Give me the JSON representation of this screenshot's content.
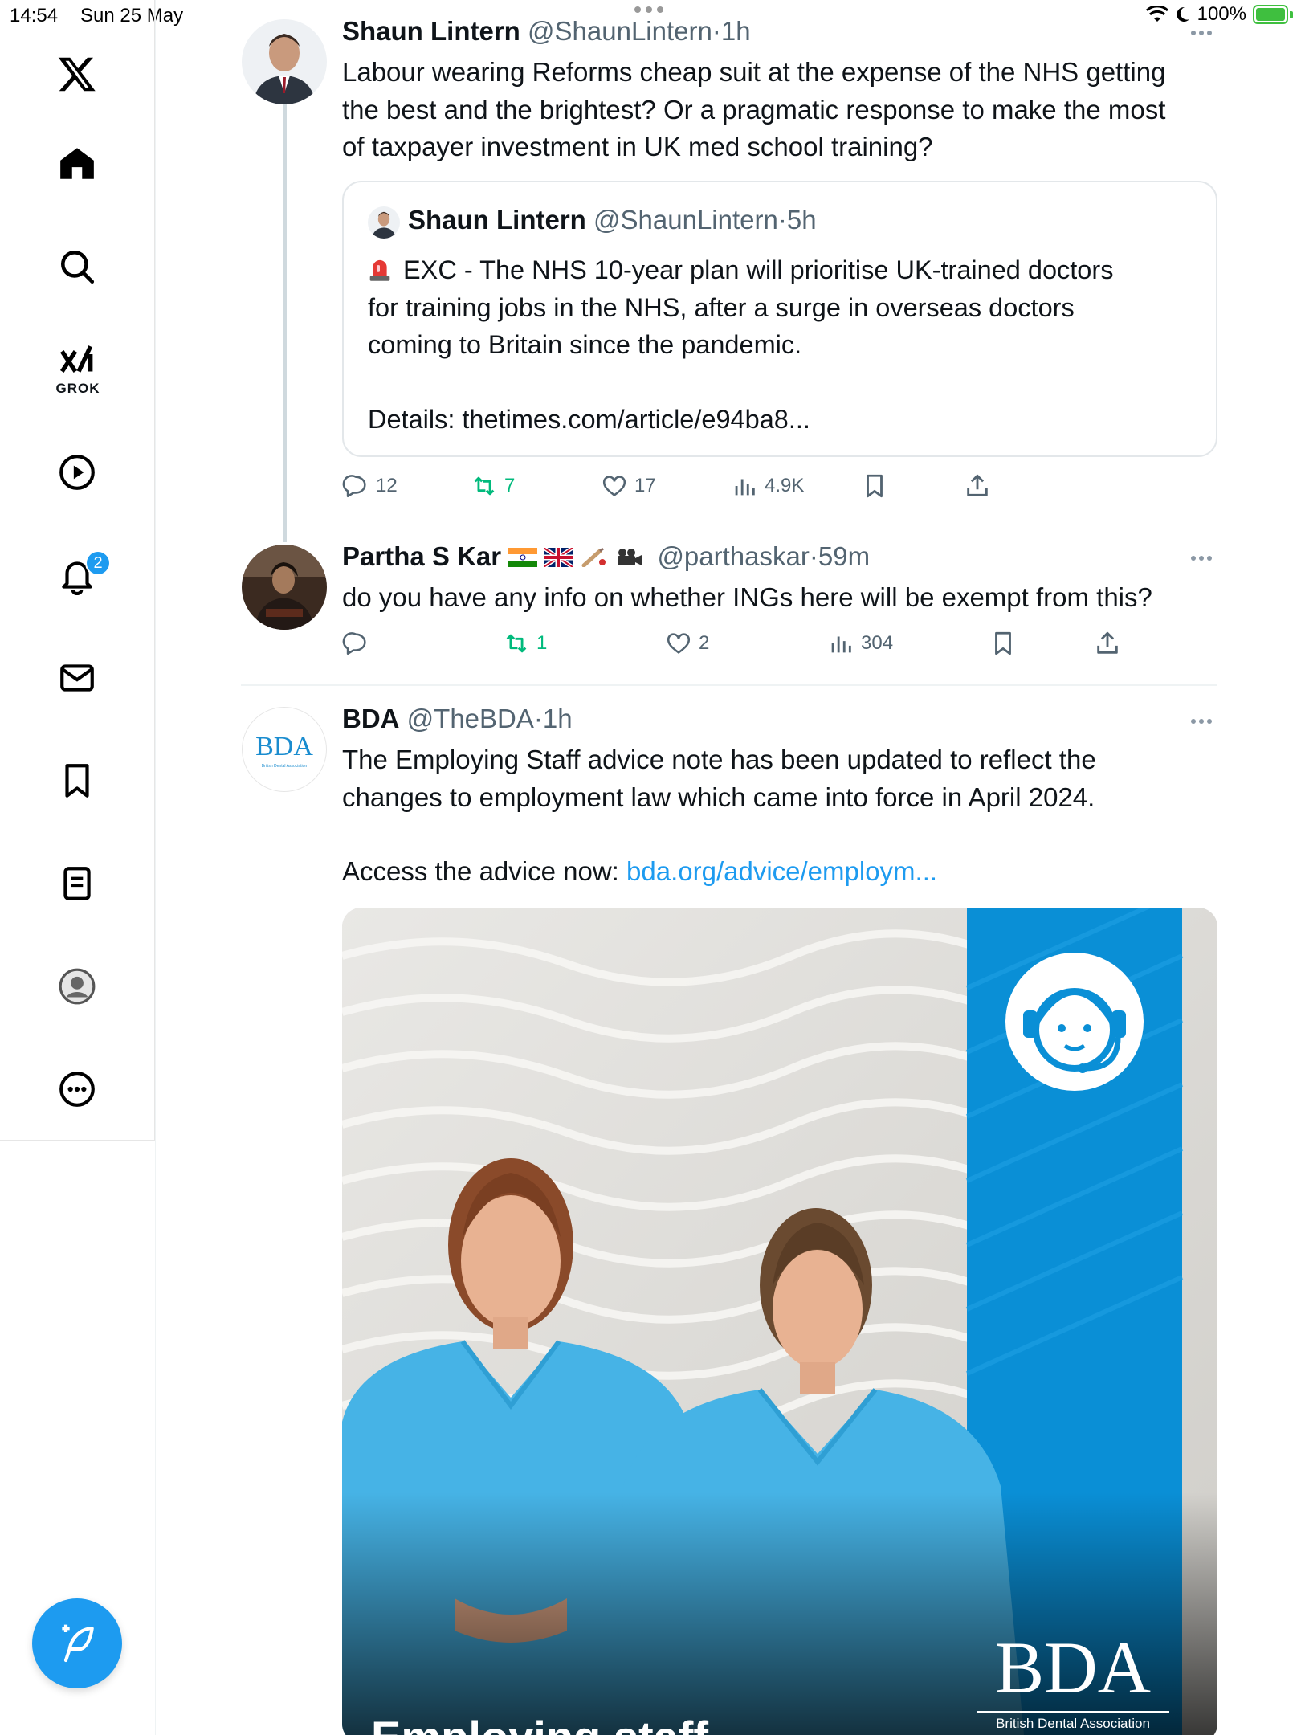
{
  "status_bar": {
    "time": "14:54",
    "date": "Sun 25 May",
    "battery": "100%"
  },
  "sidebar": {
    "grok_label": "GROK",
    "notifications_badge": "2",
    "items": [
      "x-logo",
      "home",
      "search",
      "grok",
      "videos",
      "notifications",
      "messages",
      "bookmarks",
      "lists",
      "profile",
      "more"
    ]
  },
  "tweets": [
    {
      "name": "Shaun Lintern",
      "handle": "@ShaunLintern",
      "time": "1h",
      "lines": [
        "Labour wearing Reforms cheap suit at the expense of the NHS getting",
        "the best and the brightest? Or a pragmatic response to make the most",
        "of taxpayer investment in UK med school training?"
      ],
      "quote": {
        "name": "Shaun Lintern",
        "handle": "@ShaunLintern",
        "time": "5h",
        "lines": [
          "EXC - The NHS 10-year plan will prioritise UK-trained doctors",
          "for training jobs in the NHS, after a surge in overseas doctors",
          "coming to Britain since the pandemic."
        ],
        "details": "Details: thetimes.com/article/e94ba8..."
      },
      "stats": {
        "replies": "12",
        "reposts": "7",
        "likes": "17",
        "views": "4.9K"
      }
    },
    {
      "name": "Partha S Kar",
      "handle": "@parthaskar",
      "time": "59m",
      "text": "do you have any info on whether INGs here will be exempt from this?",
      "stats": {
        "replies": "",
        "reposts": "1",
        "likes": "2",
        "views": "304"
      }
    },
    {
      "name": "BDA",
      "handle": "@TheBDA",
      "time": "1h",
      "avatar_text": "BDA",
      "avatar_subtext": "British Dental Association",
      "lines": [
        "The Employing Staff advice note has been updated to reflect the",
        "changes to employment law which came into force in April 2024."
      ],
      "access_prefix": "Access the advice now: ",
      "access_link": "bda.org/advice/employm...",
      "media": {
        "logo": "BDA",
        "logo_sub": "British Dental Association",
        "caption": "Employing staff"
      }
    }
  ],
  "colors": {
    "accent": "#1d9bf0",
    "repost": "#00ba7c",
    "muted": "#536471",
    "bda_blue": "#0a8fd6",
    "scrub_blue": "#46b3e6"
  }
}
